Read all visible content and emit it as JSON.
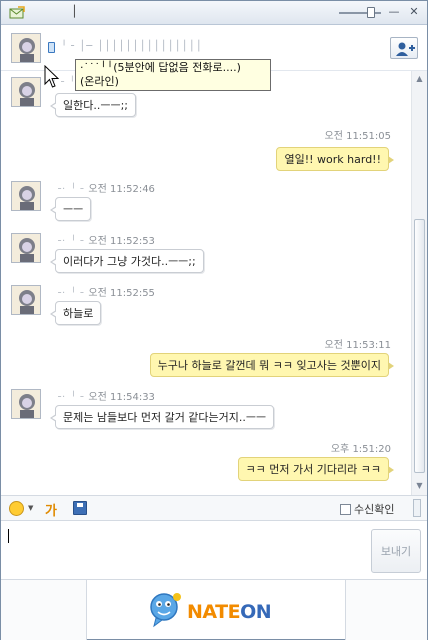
{
  "window": {
    "title": "│"
  },
  "header": {
    "buddy_line": "╵╶ │─ │││││││││││││││"
  },
  "tooltip": {
    "line1": "·˙˙˙╵╵(5분안에 답없음 전화로....)",
    "line2": "(온라인)"
  },
  "messages": [
    {
      "dir": "in",
      "nick": "╵╶ ╵╶",
      "time": "",
      "text": "일한다..ㅡㅡ;;"
    },
    {
      "dir": "out",
      "nick": "",
      "time": "오전 11:51:05",
      "text": "열일!! work hard!!"
    },
    {
      "dir": "in",
      "nick": "╶· ╵╶",
      "time": "오전 11:52:46",
      "text": "ㅡㅡ"
    },
    {
      "dir": "in",
      "nick": "╶· ╵╶",
      "time": "오전 11:52:53",
      "text": "이러다가 그냥 가것다..ㅡㅡ;;"
    },
    {
      "dir": "in",
      "nick": "╶· ╵╶",
      "time": "오전 11:52:55",
      "text": "하늘로"
    },
    {
      "dir": "out",
      "nick": "",
      "time": "오전 11:53:11",
      "text": "누구나 하늘로 갈껀데 뭐 ㅋㅋ 잊고사는 것뿐이지"
    },
    {
      "dir": "in",
      "nick": "╶· ╵╶",
      "time": "오전 11:54:33",
      "text": "문제는 남들보다 먼저 갈거 같다는거지..ㅡㅡ"
    },
    {
      "dir": "out",
      "nick": "",
      "time": "오후 1:51:20",
      "text": "ㅋㅋ 먼저 가서 기다리라 ㅋㅋ"
    }
  ],
  "toolbar": {
    "font_label": "가",
    "read_receipt_label": "수신확인"
  },
  "input": {
    "value": "",
    "send_label": "보내기"
  },
  "banner": {
    "logo_nate": "NATE",
    "logo_on": "ON"
  },
  "colors": {
    "outgoing_bubble": "#fff7b0",
    "incoming_bubble": "#ffffff",
    "brand_orange": "#f28b00",
    "brand_blue": "#3569b8"
  }
}
